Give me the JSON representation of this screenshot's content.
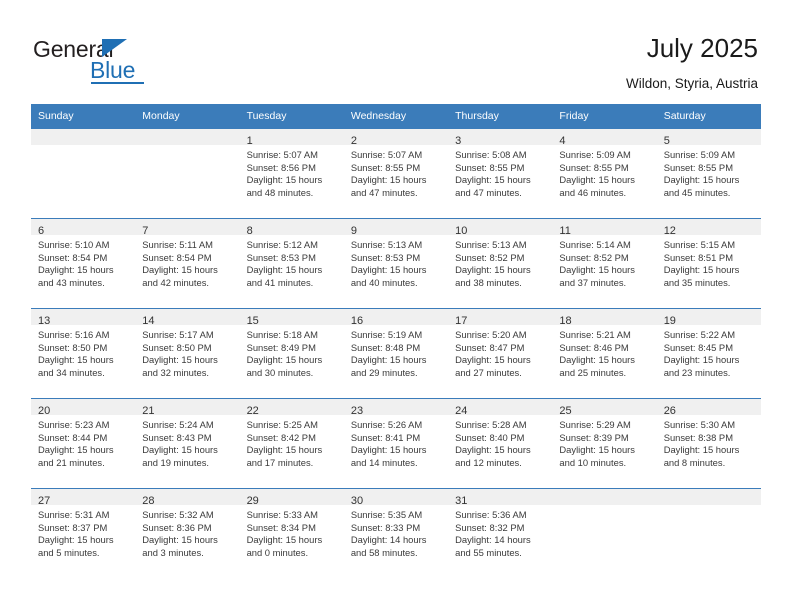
{
  "brand": {
    "name_part1": "General",
    "name_part2": "Blue",
    "accent_color": "#1f6fb4"
  },
  "header": {
    "title": "July 2025",
    "location": "Wildon, Styria, Austria"
  },
  "calendar": {
    "header_background": "#3b7cba",
    "daynum_band_background": "#f0f0f0",
    "weekdays": [
      "Sunday",
      "Monday",
      "Tuesday",
      "Wednesday",
      "Thursday",
      "Friday",
      "Saturday"
    ],
    "labels": {
      "sunrise": "Sunrise:",
      "sunset": "Sunset:",
      "daylight": "Daylight:"
    },
    "weeks": [
      [
        {
          "day": "",
          "sunrise": "",
          "sunset": "",
          "daylight_1": "",
          "daylight_2": ""
        },
        {
          "day": "",
          "sunrise": "",
          "sunset": "",
          "daylight_1": "",
          "daylight_2": ""
        },
        {
          "day": "1",
          "sunrise": "Sunrise: 5:07 AM",
          "sunset": "Sunset: 8:56 PM",
          "daylight_1": "Daylight: 15 hours",
          "daylight_2": "and 48 minutes."
        },
        {
          "day": "2",
          "sunrise": "Sunrise: 5:07 AM",
          "sunset": "Sunset: 8:55 PM",
          "daylight_1": "Daylight: 15 hours",
          "daylight_2": "and 47 minutes."
        },
        {
          "day": "3",
          "sunrise": "Sunrise: 5:08 AM",
          "sunset": "Sunset: 8:55 PM",
          "daylight_1": "Daylight: 15 hours",
          "daylight_2": "and 47 minutes."
        },
        {
          "day": "4",
          "sunrise": "Sunrise: 5:09 AM",
          "sunset": "Sunset: 8:55 PM",
          "daylight_1": "Daylight: 15 hours",
          "daylight_2": "and 46 minutes."
        },
        {
          "day": "5",
          "sunrise": "Sunrise: 5:09 AM",
          "sunset": "Sunset: 8:55 PM",
          "daylight_1": "Daylight: 15 hours",
          "daylight_2": "and 45 minutes."
        }
      ],
      [
        {
          "day": "6",
          "sunrise": "Sunrise: 5:10 AM",
          "sunset": "Sunset: 8:54 PM",
          "daylight_1": "Daylight: 15 hours",
          "daylight_2": "and 43 minutes."
        },
        {
          "day": "7",
          "sunrise": "Sunrise: 5:11 AM",
          "sunset": "Sunset: 8:54 PM",
          "daylight_1": "Daylight: 15 hours",
          "daylight_2": "and 42 minutes."
        },
        {
          "day": "8",
          "sunrise": "Sunrise: 5:12 AM",
          "sunset": "Sunset: 8:53 PM",
          "daylight_1": "Daylight: 15 hours",
          "daylight_2": "and 41 minutes."
        },
        {
          "day": "9",
          "sunrise": "Sunrise: 5:13 AM",
          "sunset": "Sunset: 8:53 PM",
          "daylight_1": "Daylight: 15 hours",
          "daylight_2": "and 40 minutes."
        },
        {
          "day": "10",
          "sunrise": "Sunrise: 5:13 AM",
          "sunset": "Sunset: 8:52 PM",
          "daylight_1": "Daylight: 15 hours",
          "daylight_2": "and 38 minutes."
        },
        {
          "day": "11",
          "sunrise": "Sunrise: 5:14 AM",
          "sunset": "Sunset: 8:52 PM",
          "daylight_1": "Daylight: 15 hours",
          "daylight_2": "and 37 minutes."
        },
        {
          "day": "12",
          "sunrise": "Sunrise: 5:15 AM",
          "sunset": "Sunset: 8:51 PM",
          "daylight_1": "Daylight: 15 hours",
          "daylight_2": "and 35 minutes."
        }
      ],
      [
        {
          "day": "13",
          "sunrise": "Sunrise: 5:16 AM",
          "sunset": "Sunset: 8:50 PM",
          "daylight_1": "Daylight: 15 hours",
          "daylight_2": "and 34 minutes."
        },
        {
          "day": "14",
          "sunrise": "Sunrise: 5:17 AM",
          "sunset": "Sunset: 8:50 PM",
          "daylight_1": "Daylight: 15 hours",
          "daylight_2": "and 32 minutes."
        },
        {
          "day": "15",
          "sunrise": "Sunrise: 5:18 AM",
          "sunset": "Sunset: 8:49 PM",
          "daylight_1": "Daylight: 15 hours",
          "daylight_2": "and 30 minutes."
        },
        {
          "day": "16",
          "sunrise": "Sunrise: 5:19 AM",
          "sunset": "Sunset: 8:48 PM",
          "daylight_1": "Daylight: 15 hours",
          "daylight_2": "and 29 minutes."
        },
        {
          "day": "17",
          "sunrise": "Sunrise: 5:20 AM",
          "sunset": "Sunset: 8:47 PM",
          "daylight_1": "Daylight: 15 hours",
          "daylight_2": "and 27 minutes."
        },
        {
          "day": "18",
          "sunrise": "Sunrise: 5:21 AM",
          "sunset": "Sunset: 8:46 PM",
          "daylight_1": "Daylight: 15 hours",
          "daylight_2": "and 25 minutes."
        },
        {
          "day": "19",
          "sunrise": "Sunrise: 5:22 AM",
          "sunset": "Sunset: 8:45 PM",
          "daylight_1": "Daylight: 15 hours",
          "daylight_2": "and 23 minutes."
        }
      ],
      [
        {
          "day": "20",
          "sunrise": "Sunrise: 5:23 AM",
          "sunset": "Sunset: 8:44 PM",
          "daylight_1": "Daylight: 15 hours",
          "daylight_2": "and 21 minutes."
        },
        {
          "day": "21",
          "sunrise": "Sunrise: 5:24 AM",
          "sunset": "Sunset: 8:43 PM",
          "daylight_1": "Daylight: 15 hours",
          "daylight_2": "and 19 minutes."
        },
        {
          "day": "22",
          "sunrise": "Sunrise: 5:25 AM",
          "sunset": "Sunset: 8:42 PM",
          "daylight_1": "Daylight: 15 hours",
          "daylight_2": "and 17 minutes."
        },
        {
          "day": "23",
          "sunrise": "Sunrise: 5:26 AM",
          "sunset": "Sunset: 8:41 PM",
          "daylight_1": "Daylight: 15 hours",
          "daylight_2": "and 14 minutes."
        },
        {
          "day": "24",
          "sunrise": "Sunrise: 5:28 AM",
          "sunset": "Sunset: 8:40 PM",
          "daylight_1": "Daylight: 15 hours",
          "daylight_2": "and 12 minutes."
        },
        {
          "day": "25",
          "sunrise": "Sunrise: 5:29 AM",
          "sunset": "Sunset: 8:39 PM",
          "daylight_1": "Daylight: 15 hours",
          "daylight_2": "and 10 minutes."
        },
        {
          "day": "26",
          "sunrise": "Sunrise: 5:30 AM",
          "sunset": "Sunset: 8:38 PM",
          "daylight_1": "Daylight: 15 hours",
          "daylight_2": "and 8 minutes."
        }
      ],
      [
        {
          "day": "27",
          "sunrise": "Sunrise: 5:31 AM",
          "sunset": "Sunset: 8:37 PM",
          "daylight_1": "Daylight: 15 hours",
          "daylight_2": "and 5 minutes."
        },
        {
          "day": "28",
          "sunrise": "Sunrise: 5:32 AM",
          "sunset": "Sunset: 8:36 PM",
          "daylight_1": "Daylight: 15 hours",
          "daylight_2": "and 3 minutes."
        },
        {
          "day": "29",
          "sunrise": "Sunrise: 5:33 AM",
          "sunset": "Sunset: 8:34 PM",
          "daylight_1": "Daylight: 15 hours",
          "daylight_2": "and 0 minutes."
        },
        {
          "day": "30",
          "sunrise": "Sunrise: 5:35 AM",
          "sunset": "Sunset: 8:33 PM",
          "daylight_1": "Daylight: 14 hours",
          "daylight_2": "and 58 minutes."
        },
        {
          "day": "31",
          "sunrise": "Sunrise: 5:36 AM",
          "sunset": "Sunset: 8:32 PM",
          "daylight_1": "Daylight: 14 hours",
          "daylight_2": "and 55 minutes."
        },
        {
          "day": "",
          "sunrise": "",
          "sunset": "",
          "daylight_1": "",
          "daylight_2": ""
        },
        {
          "day": "",
          "sunrise": "",
          "sunset": "",
          "daylight_1": "",
          "daylight_2": ""
        }
      ]
    ]
  }
}
